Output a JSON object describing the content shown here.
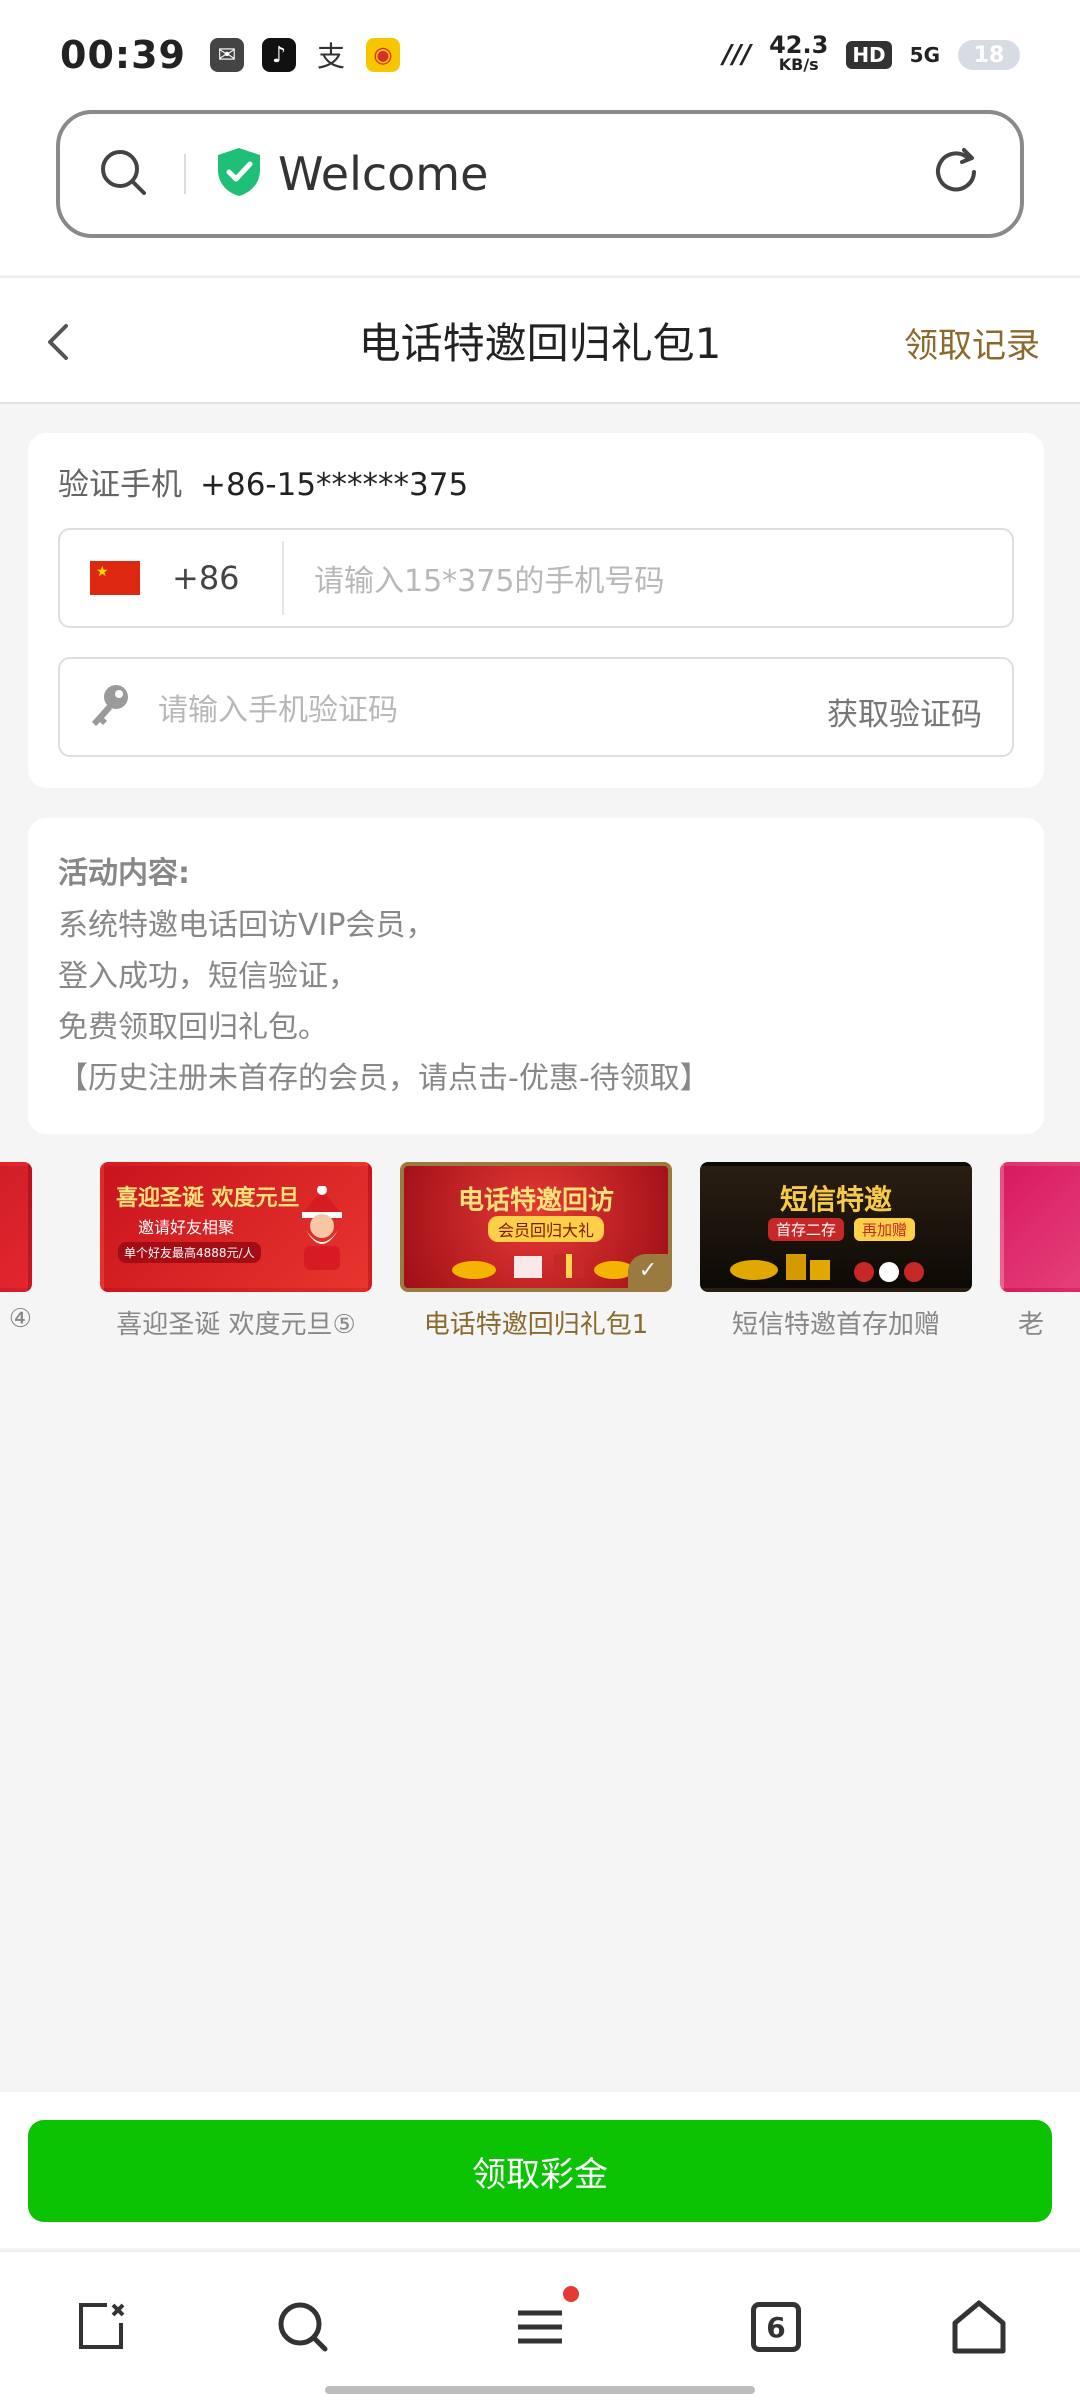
{
  "status_bar": {
    "time": "00:39",
    "net_speed_value": "42.3",
    "net_speed_unit": "KB/s",
    "hd": "HD",
    "signal": "5G",
    "battery": "18",
    "app_icons": [
      "wechat-icon",
      "tiktok-icon",
      "alipay-icon",
      "weibo-icon"
    ]
  },
  "browser": {
    "url_title": "Welcome",
    "icons": {
      "search": "search-icon",
      "secure": "shield-check-icon",
      "refresh": "refresh-icon"
    }
  },
  "header": {
    "title": "电话特邀回归礼包1",
    "records_link": "领取记录"
  },
  "verify": {
    "label": "验证手机",
    "phone": "+86-15******375",
    "country_code": "+86",
    "phone_placeholder": "请输入15*375的手机号码",
    "code_placeholder": "请输入手机验证码",
    "get_code": "获取验证码"
  },
  "activity": {
    "heading": "活动内容:",
    "lines": [
      "系统特邀电话回访VIP会员，",
      "登入成功，短信验证，",
      "免费领取回归礼包。",
      "【历史注册未首存的会员，请点击-优惠-待领取】"
    ]
  },
  "carousel": [
    {
      "label": "④",
      "banner_title": "",
      "banner_sub": "",
      "active": false
    },
    {
      "label": "喜迎圣诞 欢度元旦⑤",
      "banner_title": "喜迎圣诞 欢度元旦",
      "banner_sub": "邀请好友相聚",
      "banner_note": "单个好友最高4888元/人",
      "active": false
    },
    {
      "label": "电话特邀回归礼包1",
      "banner_title": "电话特邀回访",
      "banner_sub": "会员回归大礼",
      "active": true
    },
    {
      "label": "短信特邀首存加赠",
      "banner_title": "短信特邀",
      "banner_sub": "首存二存",
      "banner_sub2": "再加赠",
      "active": false
    },
    {
      "label": "老",
      "banner_title": "",
      "banner_sub": "",
      "active": false
    }
  ],
  "claim_button": "领取彩金",
  "bottom_nav": {
    "tab_count": "6",
    "icons": [
      "close-tab-icon",
      "search-icon",
      "menu-icon",
      "tabs-icon",
      "home-icon"
    ]
  },
  "colors": {
    "accent_gold": "#8b6a2e",
    "claim_green": "#0bc203",
    "notification_red": "#e53935"
  }
}
